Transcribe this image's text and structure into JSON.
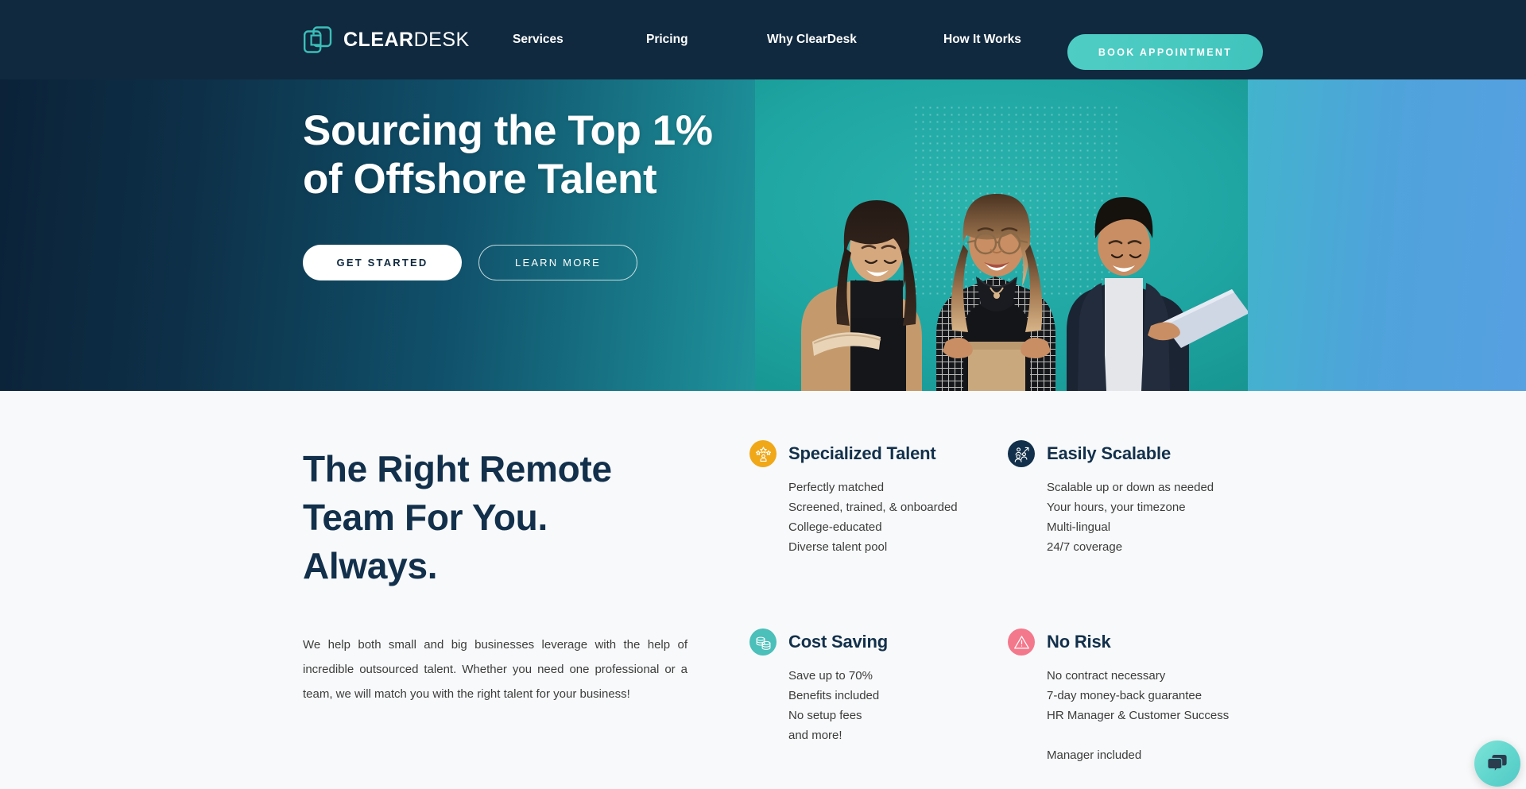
{
  "header": {
    "brand": {
      "bold": "CLEAR",
      "light": "DESK",
      "logo_icon": "overlapping-squares-logo-icon"
    },
    "nav": [
      {
        "label": "Services"
      },
      {
        "label": "Pricing"
      },
      {
        "label": "Why ClearDesk"
      },
      {
        "label": "How It Works"
      }
    ],
    "cta_label": "BOOK APPOINTMENT"
  },
  "hero": {
    "title": "Sourcing the Top 1%\nof Offshore Talent",
    "primary_button": "GET STARTED",
    "secondary_button": "LEARN MORE",
    "photo_alt": "three-smiling-professionals-photo"
  },
  "main": {
    "title": "The Right Remote\nTeam For You.\nAlways.",
    "paragraph": "We help both small and big businesses leverage with the help of incredible outsourced talent. Whether you need one professional or a team, we will match you with the right talent for your business!",
    "features": [
      {
        "title": "Specialized Talent",
        "icon": "stars-person-icon",
        "icon_color": "#F0A818",
        "items": [
          "Perfectly matched",
          "Screened, trained, & onboarded",
          "College-educated",
          "Diverse talent pool"
        ]
      },
      {
        "title": "Easily Scalable",
        "icon": "people-growth-arrow-icon",
        "icon_color": "#12304B",
        "items": [
          "Scalable up or down as needed",
          "Your hours, your timezone",
          "Multi-lingual",
          "24/7 coverage"
        ]
      },
      {
        "title": "Cost Saving",
        "icon": "stacked-coins-icon",
        "icon_color": "#4BBFBA",
        "items": [
          "Save up to 70%",
          "Benefits included",
          "No setup fees",
          "and more!"
        ]
      },
      {
        "title": "No Risk",
        "icon": "warning-triangle-icon",
        "icon_color": "#F4788C",
        "items": [
          "No contract necessary",
          "7-day money-back guarantee",
          "HR Manager & Customer Success",
          "",
          "Manager included"
        ]
      }
    ]
  },
  "chat": {
    "icon": "speech-bubbles-icon",
    "accent": "#5FD4CB"
  }
}
